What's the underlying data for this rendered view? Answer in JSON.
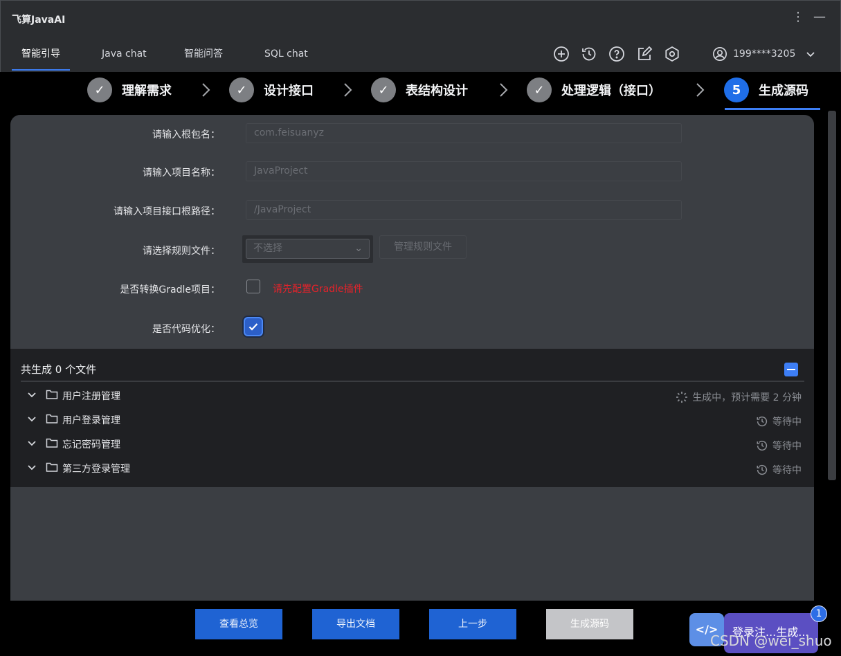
{
  "app": {
    "title": "飞算JavaAI"
  },
  "nav": {
    "tabs": [
      "智能引导",
      "Java chat",
      "智能问答",
      "SQL chat"
    ],
    "user": "199****3205"
  },
  "steps": [
    {
      "num": "✓",
      "label": "理解需求"
    },
    {
      "num": "✓",
      "label": "设计接口"
    },
    {
      "num": "✓",
      "label": "表结构设计"
    },
    {
      "num": "✓",
      "label": "处理逻辑（接口）"
    },
    {
      "num": "5",
      "label": "生成源码"
    }
  ],
  "form": {
    "package_label": "请输入根包名：",
    "package_placeholder": "com.feisuanyz",
    "project_label": "请输入项目名称：",
    "project_placeholder": "JavaProject",
    "path_label": "请输入项目接口根路径：",
    "path_placeholder": "/JavaProject",
    "rules_label": "请选择规则文件：",
    "rules_value": "不选择",
    "manage_rules": "管理规则文件",
    "gradle_label": "是否转换Gradle项目：",
    "gradle_warning": "请先配置Gradle插件",
    "optimize_label": "是否代码优化："
  },
  "files": {
    "header": "共生成 0 个文件",
    "items": [
      {
        "name": "用户注册管理",
        "status": "生成中，预计需要 2 分钟"
      },
      {
        "name": "用户登录管理",
        "status": "等待中"
      },
      {
        "name": "忘记密码管理",
        "status": "等待中"
      },
      {
        "name": "第三方登录管理",
        "status": "等待中"
      }
    ]
  },
  "buttons": {
    "overview": "查看总览",
    "export": "导出文档",
    "prev": "上一步",
    "generate": "生成源码"
  },
  "float": {
    "icon": "</>",
    "label": "登录注...生成...",
    "badge": "1"
  },
  "watermark": "CSDN @wei_shuo",
  "colors": {
    "accent": "#3d7ef5",
    "primary_button": "#1f63d3",
    "warning": "#e7222a",
    "panel": "#3b3e43"
  }
}
